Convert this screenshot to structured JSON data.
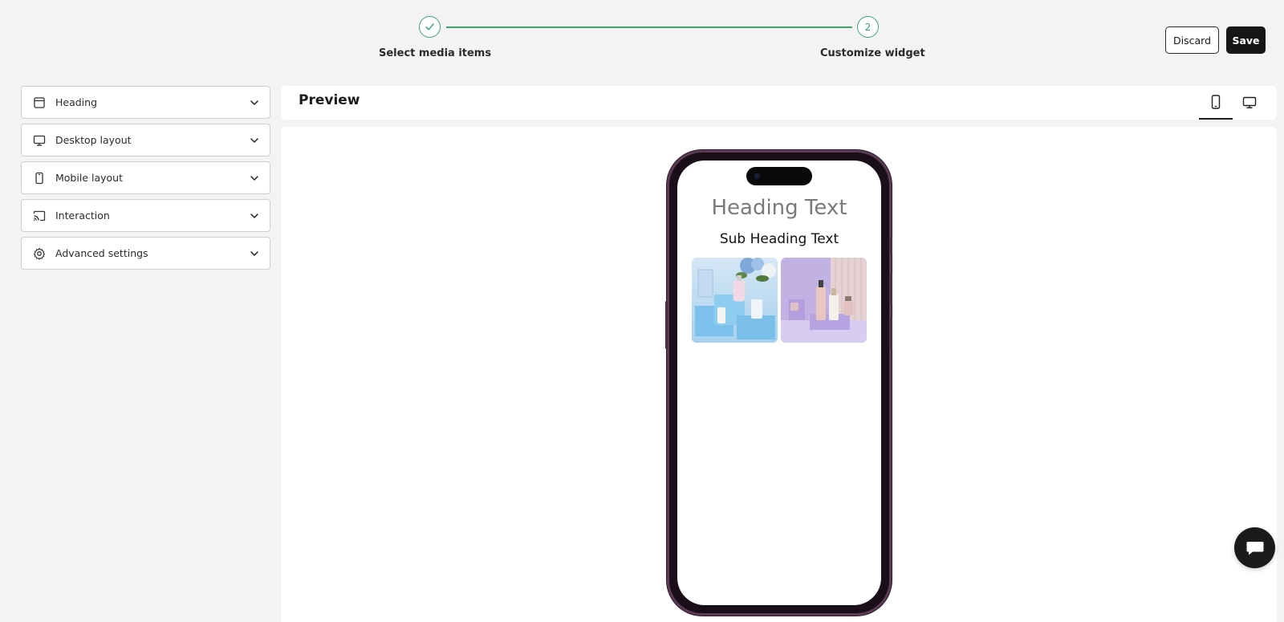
{
  "stepper": {
    "steps": [
      {
        "number": "",
        "label": "Select media items",
        "status": "complete"
      },
      {
        "number": "2",
        "label": "Customize widget",
        "status": "active"
      }
    ]
  },
  "actions": {
    "discard_label": "Discard",
    "save_label": "Save"
  },
  "sidebar": {
    "items": [
      {
        "label": "Heading",
        "icon": "heading-icon"
      },
      {
        "label": "Desktop layout",
        "icon": "desktop-icon"
      },
      {
        "label": "Mobile layout",
        "icon": "mobile-icon"
      },
      {
        "label": "Interaction",
        "icon": "cast-icon"
      },
      {
        "label": "Advanced settings",
        "icon": "gear-icon"
      }
    ]
  },
  "preview": {
    "title": "Preview",
    "active_view": "mobile",
    "phone": {
      "heading": "Heading Text",
      "subheading": "Sub Heading Text",
      "media": [
        "blue skincare product photo",
        "purple skincare product photo"
      ]
    }
  },
  "colors": {
    "accent": "#3aa76d",
    "dark": "#161616",
    "background": "#f3f3f3"
  }
}
